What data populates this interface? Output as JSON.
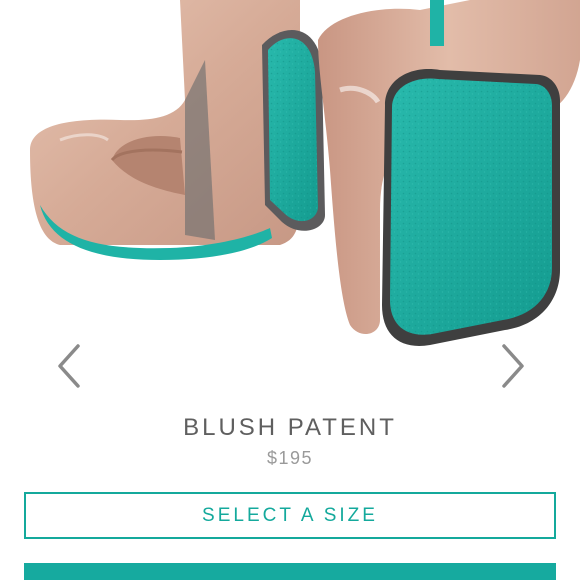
{
  "product": {
    "name": "BLUSH PATENT",
    "price": "$195",
    "image_alt": "Blush patent ballet flats with teal soles"
  },
  "actions": {
    "select_size_label": "SELECT A SIZE"
  },
  "icons": {
    "prev": "chevron-left-icon",
    "next": "chevron-right-icon"
  },
  "colors": {
    "accent": "#14a99c",
    "sole_teal": "#1fb3a6",
    "blush": "#d9b3a0",
    "text_primary": "#5f5f5f",
    "text_secondary": "#9a9a9a"
  }
}
